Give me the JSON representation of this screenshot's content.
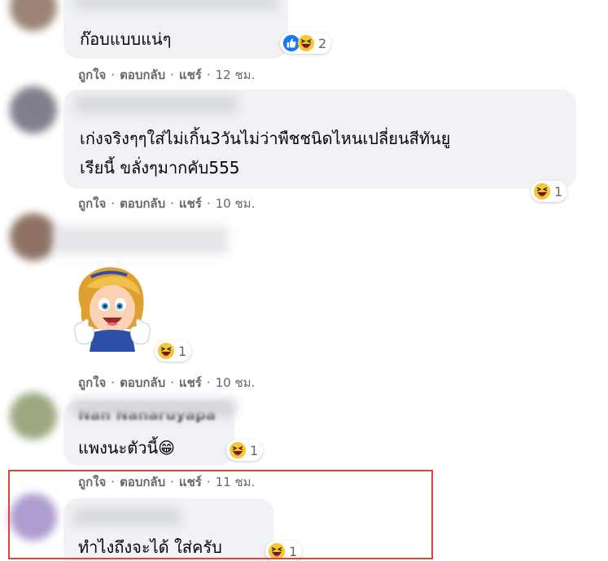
{
  "comments": [
    {
      "text_lines": [
        "ก๊อบแบบแน่ๆ"
      ],
      "reactions": {
        "types": [
          "like",
          "haha"
        ],
        "count": "2"
      },
      "actions": {
        "like": "ถูกใจ",
        "reply": "ตอบกลับ",
        "share": "แชร์",
        "time": "12 ชม."
      }
    },
    {
      "text_lines": [
        "เก่งจริงๆๆใส่ไม่เกิ้น3วันไม่ว่าพืชชนิดไหนเปลี่ยนสีทันยู",
        "เรียนี้ ขลั่งๆมากคับ555"
      ],
      "reactions": {
        "types": [
          "haha"
        ],
        "count": "1"
      },
      "actions": {
        "like": "ถูกใจ",
        "reply": "ตอบกลับ",
        "share": "แชร์",
        "time": "10 ชม."
      }
    },
    {
      "sticker": "thumbs-up-girl-sticker",
      "reactions": {
        "types": [
          "haha"
        ],
        "count": "1"
      },
      "actions": {
        "like": "ถูกใจ",
        "reply": "ตอบกลับ",
        "share": "แชร์",
        "time": "10 ชม."
      }
    },
    {
      "author_partial": "Nan Nanaruyapa",
      "text_lines": [
        "แพงนะตัวนี้"
      ],
      "emoji": "😁",
      "reactions": {
        "types": [
          "haha"
        ],
        "count": "1"
      },
      "actions": {
        "like": "ถูกใจ",
        "reply": "ตอบกลับ",
        "share": "แชร์",
        "time": "11 ชม."
      }
    },
    {
      "text_lines": [
        "ทำไงถึงจะได้ ใส่ครับ"
      ],
      "reactions": {
        "types": [
          "haha"
        ],
        "count": "1"
      }
    }
  ],
  "colors": {
    "bubble": "#f0f2f5",
    "meta_text": "#65676b",
    "highlight": "#e0443e",
    "like_blue": "#1877f2",
    "haha_yellow": "#f7c73a"
  }
}
